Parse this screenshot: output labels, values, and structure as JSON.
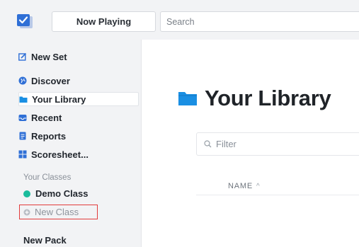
{
  "topbar": {
    "now_playing_label": "Now Playing",
    "search_placeholder": "Search"
  },
  "sidebar": {
    "new_set_label": "New Set",
    "items": [
      {
        "label": "Discover",
        "icon": "globe-icon"
      },
      {
        "label": "Your Library",
        "icon": "folder-icon",
        "active": true
      },
      {
        "label": "Recent",
        "icon": "inbox-icon"
      },
      {
        "label": "Reports",
        "icon": "report-icon"
      },
      {
        "label": "Scoresheet...",
        "icon": "grid-icon"
      }
    ],
    "classes_heading": "Your Classes",
    "classes": [
      {
        "label": "Demo Class",
        "color": "#1abc9c"
      }
    ],
    "new_class_label": "New Class",
    "new_pack_label": "New Pack"
  },
  "main": {
    "title": "Your Library",
    "filter_placeholder": "Filter",
    "column_name": "NAME",
    "column_sort": "^"
  },
  "colors": {
    "accent": "#2f6fd6",
    "folder": "#1a8fe3",
    "highlight": "#e23b3b"
  }
}
